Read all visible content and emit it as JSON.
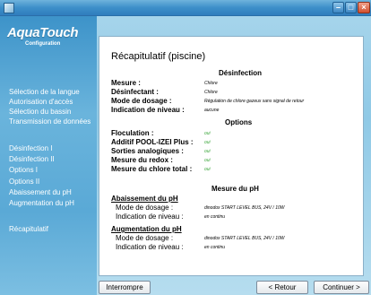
{
  "colors": {
    "accent": "#3d8fc9",
    "value_green": "#3aa63a"
  },
  "app": {
    "logo": "AquaTouch",
    "logo_sub": "Configuration",
    "footer": ""
  },
  "sidebar": {
    "items": [
      "Sélection de la langue",
      "Autorisation d'accès",
      "Sélection du bassin",
      "Transmission de données",
      "Désinfection I",
      "Désinfection II",
      "Options I",
      "Options II",
      "Abaissement du pH",
      "Augmentation du pH",
      "Récapitulatif"
    ]
  },
  "panel": {
    "title": "Récapitulatif (piscine)",
    "desinfection": {
      "heading": "Désinfection",
      "rows": [
        {
          "label": "Mesure :",
          "value": "Chlore"
        },
        {
          "label": "Désinfectant :",
          "value": "Chlore"
        },
        {
          "label": "Mode de dosage :",
          "value": "Régulation de chlore gazeux sans signal de retour"
        },
        {
          "label": "Indication de niveau :",
          "value": "aucune"
        }
      ]
    },
    "options": {
      "heading": "Options",
      "rows": [
        {
          "label": "Floculation :",
          "value": "oui"
        },
        {
          "label": "Additif POOL-IZEI Plus :",
          "value": "oui"
        },
        {
          "label": "Sorties analogiques :",
          "value": "oui"
        },
        {
          "label": "Mesure du redox :",
          "value": "oui"
        },
        {
          "label": "Mesure du chlore total :",
          "value": "oui"
        }
      ]
    },
    "ph": {
      "heading": "Mesure du pH",
      "abaissement": {
        "heading": "Abaissement du pH",
        "rows": [
          {
            "label": "Mode de dosage :",
            "value": "dinodox START LEVEL BUS, 24V / 10W"
          },
          {
            "label": "Indication de niveau :",
            "value": "en continu"
          }
        ]
      },
      "augmentation": {
        "heading": "Augmentation du pH",
        "rows": [
          {
            "label": "Mode de dosage :",
            "value": "dinodox START LEVEL BUS, 24V / 10W"
          },
          {
            "label": "Indication de niveau :",
            "value": "en continu"
          }
        ]
      }
    }
  },
  "buttons": {
    "stop": "Interrompre",
    "back": "< Retour",
    "next": "Continuer >"
  }
}
